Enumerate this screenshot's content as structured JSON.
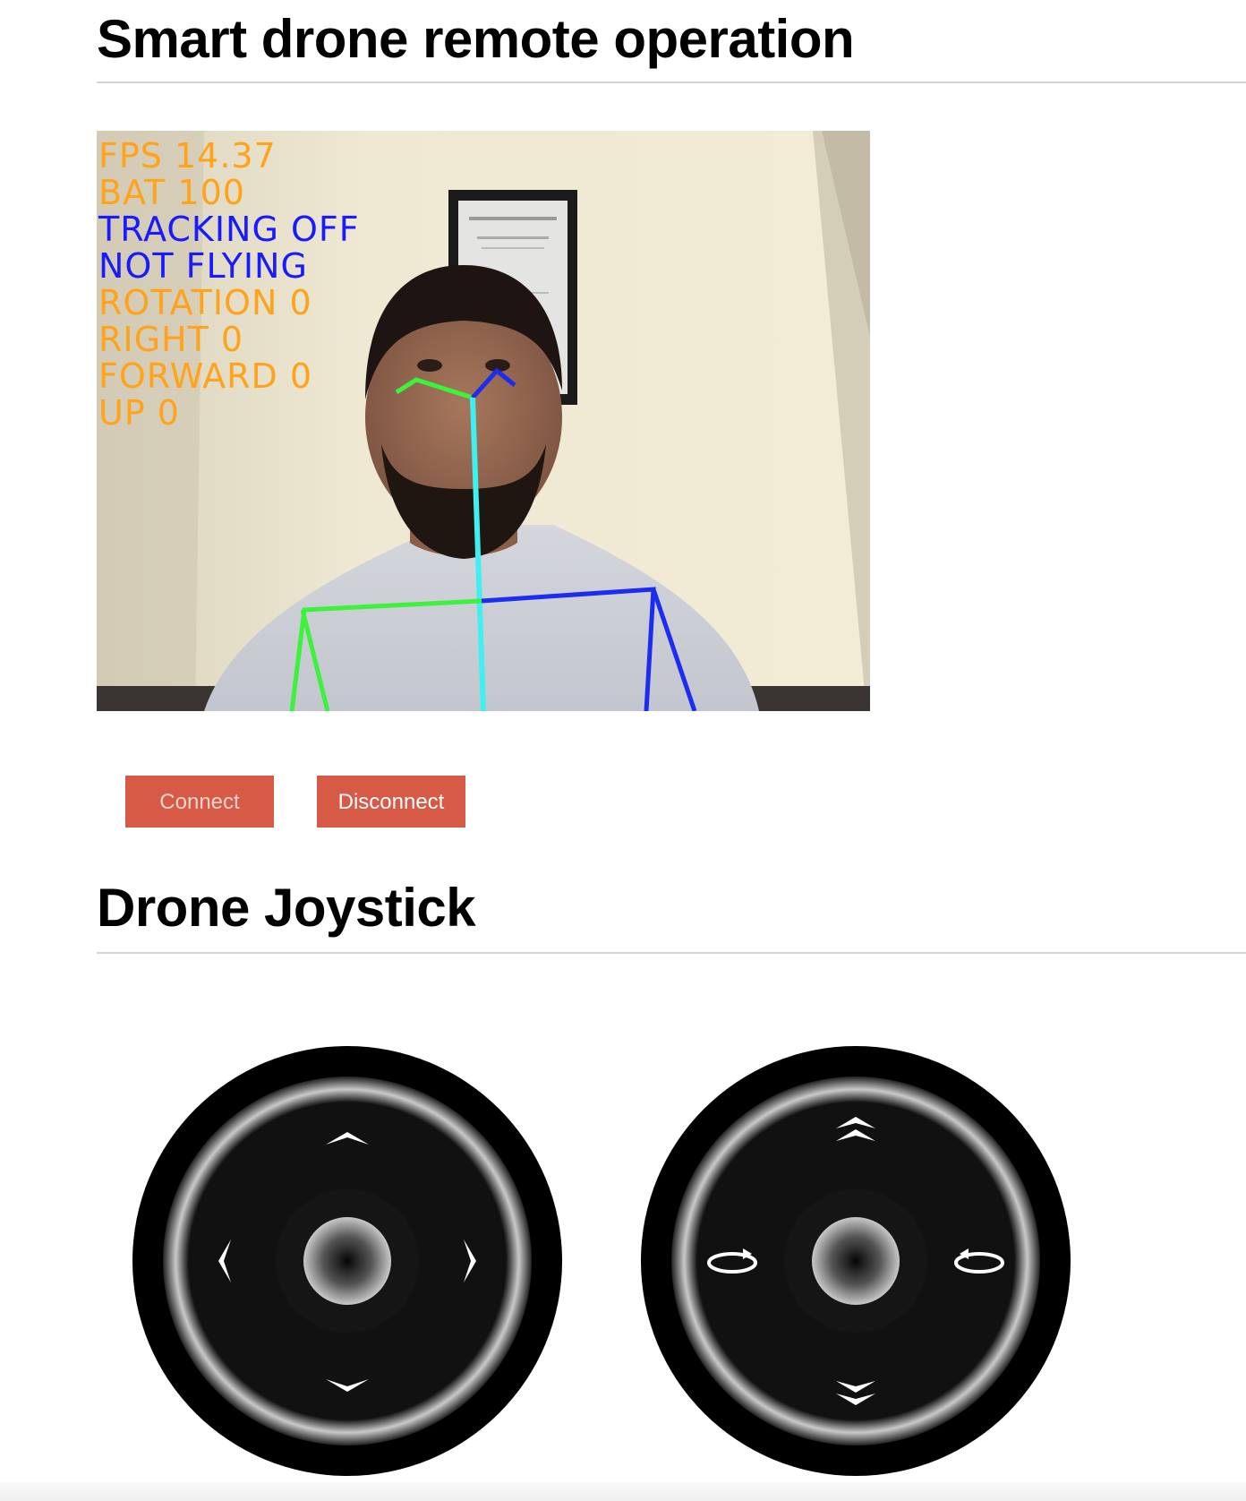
{
  "page": {
    "title": "Smart drone remote operation",
    "joystick_title": "Drone Joystick"
  },
  "video": {
    "overlay": {
      "fps": "FPS 14.37",
      "battery": "BAT 100",
      "tracking": "TRACKING OFF",
      "flying": "NOT FLYING",
      "rotation": "ROTATION 0",
      "right": "RIGHT 0",
      "forward": "FORWARD 0",
      "up": "UP 0"
    },
    "colors": {
      "overlay_orange": "#ffa31a",
      "overlay_blue": "#1a1aff",
      "skeleton_green": "#3cf23c",
      "skeleton_blue": "#1c2cf0",
      "skeleton_cyan": "#40f0f0"
    }
  },
  "controls": {
    "connect_label": "Connect",
    "disconnect_label": "Disconnect",
    "button_color": "#d65a46"
  },
  "joysticks": {
    "left": {
      "icons": [
        "up-arrow-icon",
        "left-arrow-icon",
        "right-arrow-icon",
        "down-arrow-icon"
      ]
    },
    "right": {
      "icons": [
        "ascend-icon",
        "rotate-left-icon",
        "rotate-right-icon",
        "descend-icon"
      ]
    }
  }
}
